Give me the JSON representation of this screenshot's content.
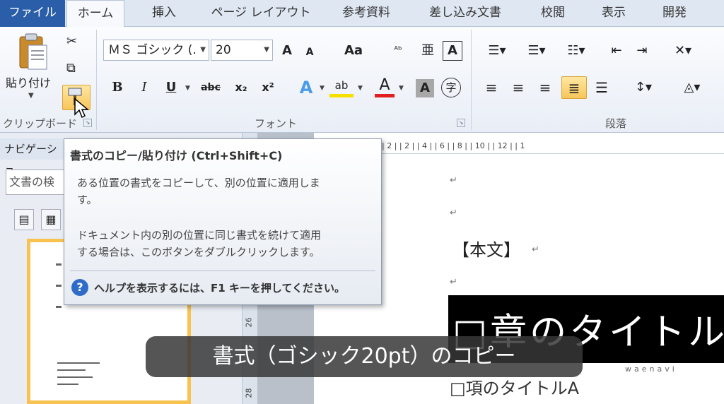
{
  "tabs": [
    {
      "label": "ファイル"
    },
    {
      "label": "ホーム"
    },
    {
      "label": "挿入"
    },
    {
      "label": "ページ レイアウト"
    },
    {
      "label": "参考資料"
    },
    {
      "label": "差し込み文書"
    },
    {
      "label": "校閲"
    },
    {
      "label": "表示"
    },
    {
      "label": "開発"
    }
  ],
  "ribbon": {
    "clipboard": {
      "paste_label": "貼り付け",
      "group_label": "クリップボード"
    },
    "font": {
      "font_name": "ＭＳ ゴシック (.",
      "font_size": "20",
      "grow": "A",
      "shrink": "A",
      "case": "Aa",
      "bold": "B",
      "italic": "I",
      "underline": "U",
      "strike": "abc",
      "subscript": "x₂",
      "superscript": "x²",
      "text_effect": "A",
      "highlight": "ab",
      "font_color": "A",
      "shading": "A",
      "enclose": "字",
      "phonetic": "亜",
      "border": "A",
      "group_label": "フォント"
    },
    "paragraph": {
      "group_label": "段落"
    }
  },
  "nav": {
    "header": "ナビゲーショ",
    "search_placeholder": "文書の検"
  },
  "ruler": {
    "h_marks": "| 2 |         | 2 |  | 4 |  | 6 |  | 8 |  | 10 |  | 12 |  | 1",
    "v_marks": [
      "26",
      "28"
    ]
  },
  "tooltip": {
    "title": "書式のコピー/貼り付け (Ctrl+Shift+C)",
    "body1_line1": "ある位置の書式をコピーして、別の位置に適用しま",
    "body1_line2": "す。",
    "body2_line1": "ドキュメント内の別の位置に同じ書式を続けて適用",
    "body2_line2": "する場合は、このボタンをダブルクリックします。",
    "help": "ヘルプを表示するには、F1 キーを押してください。",
    "help_icon": "?"
  },
  "document": {
    "para_mark": "↵",
    "honbun": "【本文】",
    "chapter_title": "□章のタイトル",
    "watermark": "waenavi",
    "section_title": "□項のタイトルA"
  },
  "caption": "書式（ゴシック20pt）のコピー",
  "colors": {
    "file_tab": "#2a5ea8",
    "highlight": "#f7c659",
    "caption_bg": "#373737",
    "title_band": "#000000"
  }
}
